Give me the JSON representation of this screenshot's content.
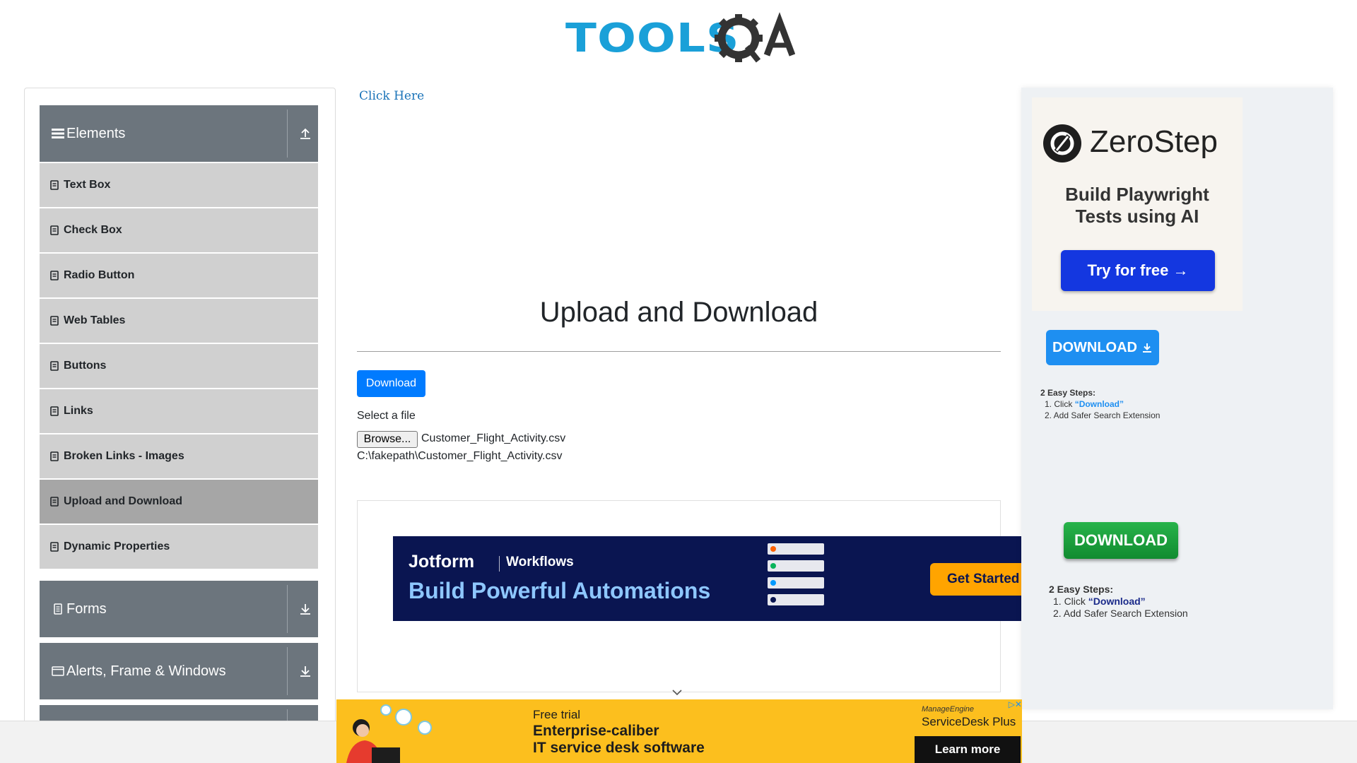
{
  "header": {
    "logo_text": "TOOLS",
    "logo_suffix": "QA"
  },
  "sidebar": {
    "groups": [
      {
        "label": "Elements",
        "icon": "menu-icon",
        "state": "expanded"
      },
      {
        "label": "Forms",
        "icon": "file-icon",
        "state": "collapsed"
      },
      {
        "label": "Alerts, Frame & Windows",
        "icon": "window-icon",
        "state": "collapsed"
      }
    ],
    "items": [
      {
        "label": "Text Box"
      },
      {
        "label": "Check Box"
      },
      {
        "label": "Radio Button"
      },
      {
        "label": "Web Tables"
      },
      {
        "label": "Buttons"
      },
      {
        "label": "Links"
      },
      {
        "label": "Broken Links - Images"
      },
      {
        "label": "Upload and Download",
        "active": true
      },
      {
        "label": "Dynamic Properties"
      }
    ]
  },
  "main": {
    "click_here": "Click Here",
    "title": "Upload and Download",
    "download_button": "Download",
    "select_file_label": "Select a file",
    "browse_button": "Browse...",
    "selected_file": "Customer_Flight_Activity.csv",
    "uploaded_path": "C:\\fakepath\\Customer_Flight_Activity.csv"
  },
  "ads": {
    "jotform": {
      "brand": "Jotform",
      "product": "Workflows",
      "headline": "Build Powerful Automations",
      "cta": "Get Started"
    },
    "zerostep": {
      "brand": "ZeroStep",
      "tagline_line1": "Build Playwright",
      "tagline_line2": "Tests using AI",
      "cta": "Try for free →"
    },
    "safer_search_1": {
      "button": "DOWNLOAD",
      "steps_title": "2 Easy Steps:",
      "step1_prefix": "1. Click ",
      "step1_highlight": "“Download”",
      "step2": "2. Add Safer Search Extension"
    },
    "safer_search_2": {
      "button": "DOWNLOAD",
      "steps_title": "2 Easy Steps:",
      "step1_prefix": "1. Click ",
      "step1_highlight": "“Download”",
      "step2": "2. Add Safer Search Extension"
    },
    "bottom": {
      "free_trial": "Free trial",
      "line1": "Enterprise-caliber",
      "line2": "IT service desk software",
      "brand": "ManageEngine",
      "product": "ServiceDesk Plus",
      "cta": "Learn more"
    }
  },
  "colors": {
    "sidebar_header": "#6c757d",
    "sidebar_item": "#d0d0d0",
    "sidebar_item_active": "#a6a6a6",
    "primary": "#007bff",
    "logo_blue": "#1aa0d8"
  }
}
